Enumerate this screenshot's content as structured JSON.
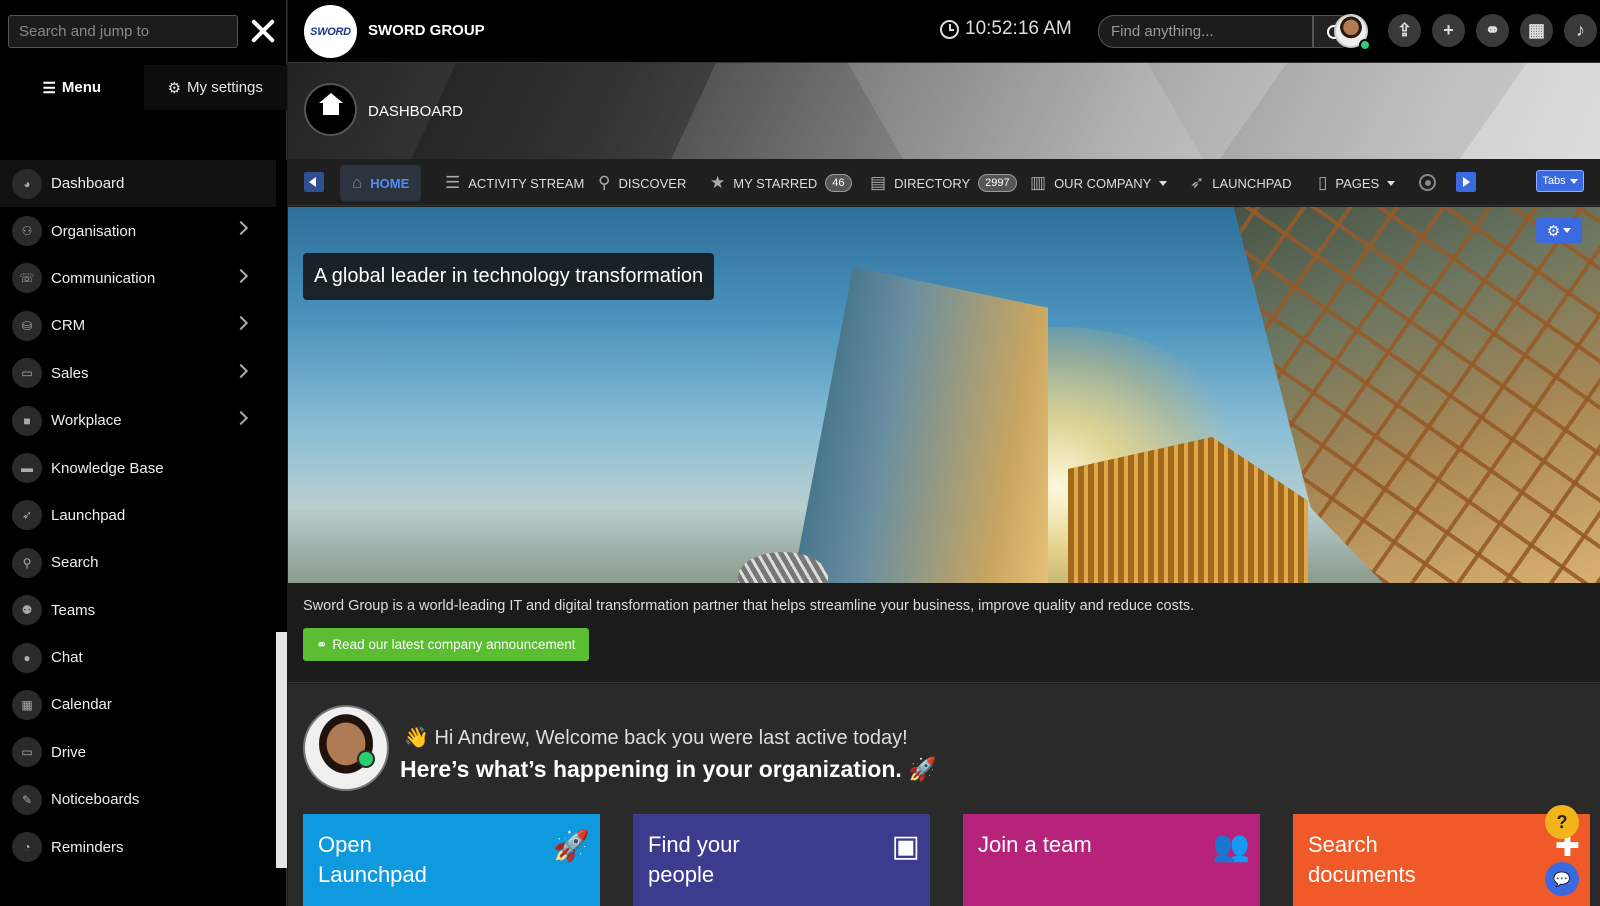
{
  "sidebar": {
    "search_placeholder": "Search and jump to",
    "close_icon": "close-icon",
    "tabs": [
      {
        "label": "Menu",
        "icon": "menu-icon"
      },
      {
        "label": "My settings",
        "icon": "user-settings-icon"
      }
    ],
    "items": [
      {
        "label": "Dashboard",
        "icon": "dashboard-icon",
        "active": true,
        "has_children": false
      },
      {
        "label": "Organisation",
        "icon": "organisation-icon",
        "has_children": true
      },
      {
        "label": "Communication",
        "icon": "communication-icon",
        "has_children": true
      },
      {
        "label": "CRM",
        "icon": "crm-icon",
        "has_children": true
      },
      {
        "label": "Sales",
        "icon": "sales-icon",
        "has_children": true
      },
      {
        "label": "Workplace",
        "icon": "workplace-icon",
        "has_children": true
      },
      {
        "label": "Knowledge Base",
        "icon": "folder-icon",
        "has_children": false
      },
      {
        "label": "Launchpad",
        "icon": "rocket-icon",
        "has_children": false
      },
      {
        "label": "Search",
        "icon": "search-icon",
        "has_children": false
      },
      {
        "label": "Teams",
        "icon": "teams-icon",
        "has_children": false
      },
      {
        "label": "Chat",
        "icon": "chat-icon",
        "has_children": false
      },
      {
        "label": "Calendar",
        "icon": "calendar-icon",
        "has_children": false
      },
      {
        "label": "Drive",
        "icon": "drive-icon",
        "has_children": false
      },
      {
        "label": "Noticeboards",
        "icon": "pin-icon",
        "has_children": false
      },
      {
        "label": "Reminders",
        "icon": "stopwatch-icon",
        "has_children": false
      }
    ]
  },
  "topbar": {
    "logo_text": "SWORD",
    "brand": "SWORD GROUP",
    "time": "10:52:16 AM",
    "search_placeholder": "Find anything...",
    "online_color": "#2ecc71",
    "icon_buttons": [
      {
        "name": "upload-icon",
        "glyph": "⇪"
      },
      {
        "name": "plus-icon",
        "glyph": "+"
      },
      {
        "name": "link-icon",
        "glyph": "⚭"
      },
      {
        "name": "calendar-icon",
        "glyph": "▦"
      },
      {
        "name": "bell-icon",
        "glyph": "♪"
      }
    ]
  },
  "page": {
    "title": "DASHBOARD"
  },
  "nav": {
    "items": [
      {
        "label": "HOME",
        "icon": "home-icon",
        "active": true
      },
      {
        "label": "ACTIVITY STREAM",
        "icon": "list-icon"
      },
      {
        "label": "DISCOVER",
        "icon": "search-icon"
      },
      {
        "label": "MY STARRED",
        "icon": "star-icon",
        "badge": "46"
      },
      {
        "label": "DIRECTORY",
        "icon": "contact-card-icon",
        "badge": "2997"
      },
      {
        "label": "OUR COMPANY",
        "icon": "building-icon",
        "dropdown": true
      },
      {
        "label": "LAUNCHPAD",
        "icon": "rocket-icon"
      },
      {
        "label": "PAGES",
        "icon": "page-icon",
        "dropdown": true
      }
    ],
    "tabs_label": "Tabs"
  },
  "hero": {
    "caption": "A global leader in technology transformation"
  },
  "intro": {
    "text": "Sword Group is a world-leading IT and digital transformation partner that helps streamline your business, improve quality and reduce costs.",
    "button_label": "Read our latest company announcement",
    "button_color": "#5bbd32"
  },
  "welcome": {
    "greeting": "👋 Hi Andrew, Welcome back you were last active today!",
    "headline": "Here’s what’s happening in your organization. 🚀"
  },
  "cards": [
    {
      "title": "Open Launchpad",
      "icon": "rocket-icon",
      "glyph": "🚀",
      "color": "#0f9ae0"
    },
    {
      "title": "Find your people",
      "icon": "contact-card-icon",
      "glyph": "▣",
      "color": "#3d3b8e"
    },
    {
      "title": "Join a team",
      "icon": "users-icon",
      "glyph": "👥",
      "color": "#b7237b"
    },
    {
      "title": "Search documents",
      "icon": "file-plus-icon",
      "glyph": "✚",
      "color": "#f05a28"
    }
  ],
  "floating": {
    "help_label": "?",
    "chat_icon": "chat-bubbles-icon"
  }
}
